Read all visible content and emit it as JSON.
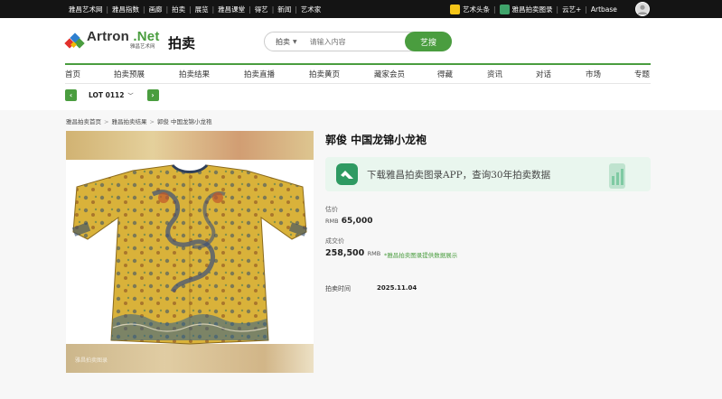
{
  "topbar": {
    "links": [
      "雅昌艺术网",
      "雅昌指数",
      "画廊",
      "拍卖",
      "展览",
      "雅昌课堂",
      "得艺",
      "新闻",
      "艺术家"
    ],
    "right_items": [
      "艺术头条",
      "雅昌拍卖图录"
    ],
    "right_links": [
      "云艺+",
      "Artbase"
    ]
  },
  "logo": {
    "en_main": "Artron",
    "en_net": ".Net",
    "cn": "雅昌艺术网"
  },
  "page_section": "拍卖",
  "search": {
    "category": "拍卖",
    "placeholder": "请输入内容",
    "button": "艺搜"
  },
  "nav": [
    "首页",
    "拍卖预展",
    "拍卖结果",
    "拍卖直播",
    "拍卖黄页",
    "藏家会员",
    "得藏",
    "资讯",
    "对话",
    "市场",
    "专题"
  ],
  "lot": {
    "label": "LOT 0112"
  },
  "breadcrumb": [
    "雅昌拍卖首页",
    "雅昌拍卖结果",
    "郭俊 中国龙锦小龙袍"
  ],
  "watermark": "雅昌拍卖图录",
  "item": {
    "title": "郭俊 中国龙锦小龙袍",
    "banner_text": "下载雅昌拍卖图录APP，查询30年拍卖数据",
    "estimate_label": "估价",
    "estimate_currency": "RMB",
    "estimate_value": "65,000",
    "sold_label": "成交价",
    "sold_value": "258,500",
    "sold_currency": "RMB",
    "sold_note": "*雅昌拍卖图录提供数据展示",
    "date_label": "拍卖时间",
    "date_value": "2025.11.04"
  },
  "colors": {
    "brand_green": "#4a9d3f",
    "topbar": "#141414",
    "robe_yellow": "#d9b23a"
  }
}
